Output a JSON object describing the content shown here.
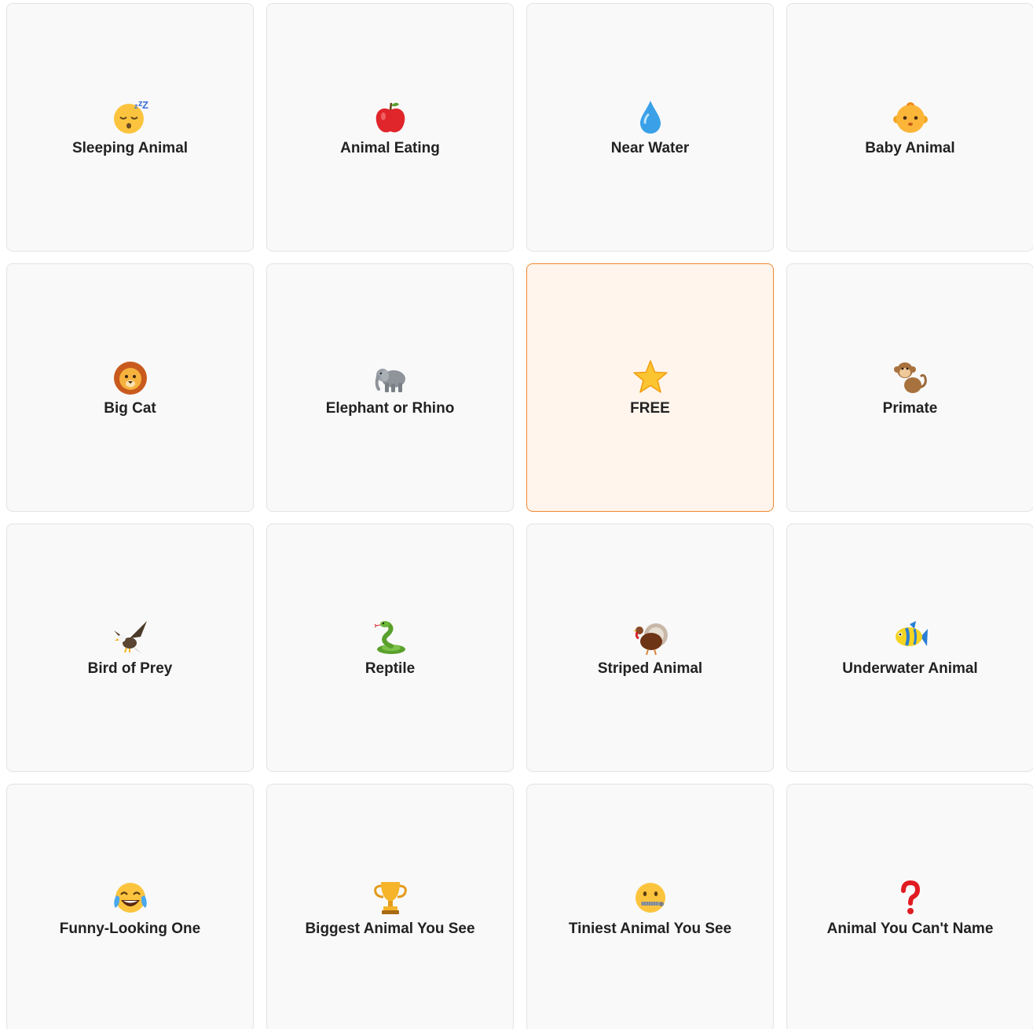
{
  "board": {
    "squares": [
      {
        "label": "Sleeping Animal",
        "icon": "sleeping-face-icon",
        "free": false
      },
      {
        "label": "Animal Eating",
        "icon": "red-apple-icon",
        "free": false
      },
      {
        "label": "Near Water",
        "icon": "water-droplet-icon",
        "free": false
      },
      {
        "label": "Baby Animal",
        "icon": "baby-face-icon",
        "free": false
      },
      {
        "label": "Big Cat",
        "icon": "lion-face-icon",
        "free": false
      },
      {
        "label": "Elephant or Rhino",
        "icon": "elephant-icon",
        "free": false
      },
      {
        "label": "FREE",
        "icon": "star-icon",
        "free": true
      },
      {
        "label": "Primate",
        "icon": "monkey-icon",
        "free": false
      },
      {
        "label": "Bird of Prey",
        "icon": "eagle-icon",
        "free": false
      },
      {
        "label": "Reptile",
        "icon": "snake-icon",
        "free": false
      },
      {
        "label": "Striped Animal",
        "icon": "turkey-icon",
        "free": false
      },
      {
        "label": "Underwater Animal",
        "icon": "tropical-fish-icon",
        "free": false
      },
      {
        "label": "Funny-Looking One",
        "icon": "tears-of-joy-face-icon",
        "free": false
      },
      {
        "label": "Biggest Animal You See",
        "icon": "trophy-icon",
        "free": false
      },
      {
        "label": "Tiniest Animal You See",
        "icon": "zipper-mouth-face-icon",
        "free": false
      },
      {
        "label": "Animal You Can't Name",
        "icon": "question-mark-icon",
        "free": false
      }
    ]
  },
  "colors": {
    "cell_background": "#f9f9f9",
    "cell_border": "#e3e3e3",
    "free_background": "#fff5ec",
    "free_border": "#f0872f",
    "label_text": "#222222"
  }
}
